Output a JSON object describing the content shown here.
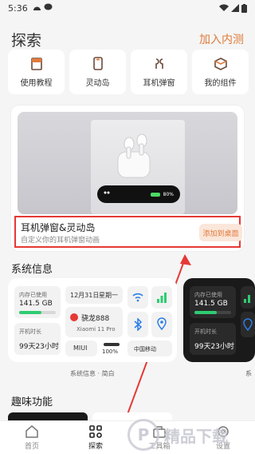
{
  "status_bar": {
    "time": "5:36"
  },
  "header": {
    "title": "探索",
    "join_label": "加入内测"
  },
  "quick_links": [
    {
      "label": "使用教程",
      "icon": "book-icon"
    },
    {
      "label": "灵动岛",
      "icon": "phone-icon"
    },
    {
      "label": "耳机弹窗",
      "icon": "earbuds-icon"
    },
    {
      "label": "我的组件",
      "icon": "box-icon"
    }
  ],
  "hero": {
    "title": "耳机弹窗&灵动岛",
    "subtitle": "自定义你的耳机弹窗动画",
    "button_label": "添加到桌面",
    "battery_text": "80%"
  },
  "system_info": {
    "section_title": "系统信息",
    "caption": "系统信息 · 简白",
    "caption2": "系",
    "memory_label": "内存已使用",
    "memory_value": "141.5 GB",
    "uptime_label": "开机时长",
    "uptime_value": "99天23小时",
    "date": "12月31日",
    "weekday": "星期一",
    "chip": "骁龙888",
    "device": "Xiaomi 11 Pro",
    "os": "MIUI",
    "percent": "100%",
    "carrier": "中国移动"
  },
  "fun": {
    "section_title": "趣味功能"
  },
  "nav": [
    {
      "label": "首页",
      "icon": "home-icon"
    },
    {
      "label": "探索",
      "icon": "explore-icon"
    },
    {
      "label": "工具箱",
      "icon": "toolbox-icon"
    },
    {
      "label": "设置",
      "icon": "settings-icon"
    }
  ],
  "colors": {
    "accent": "#e07a3a",
    "highlight": "#e53935",
    "battery_green": "#4cd964"
  },
  "watermark": "精品下载"
}
